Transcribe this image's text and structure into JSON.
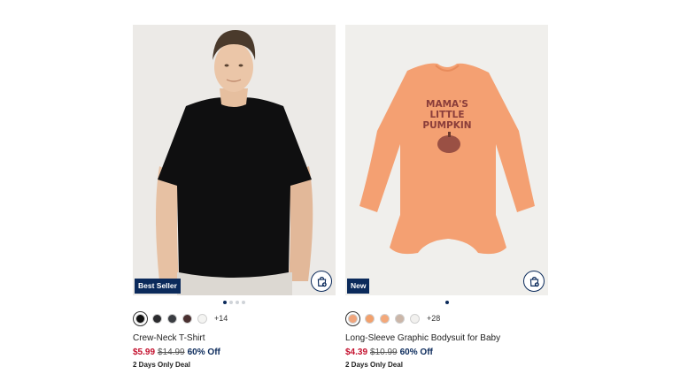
{
  "products": [
    {
      "badge": "Best Seller",
      "swatches_more": "+14",
      "swatch_colors": [
        "#111111",
        "#2b2b2e",
        "#3a3d42",
        "#4a3030",
        "#f4f4f2"
      ],
      "title": "Crew-Neck T-Shirt",
      "sale_price": "$5.99",
      "original_price": "$14.99",
      "discount": "60% Off",
      "deal": "2 Days Only Deal",
      "carousel_pages": 4,
      "carousel_active": 0
    },
    {
      "badge": "New",
      "swatches_more": "+28",
      "swatch_colors": [
        "#f0a57c",
        "#f2a06c",
        "#f3a87a",
        "#cbb6a8",
        "#f2f1ef"
      ],
      "title": "Long-Sleeve Graphic Bodysuit for Baby",
      "sale_price": "$4.39",
      "original_price": "$10.99",
      "discount": "60% Off",
      "deal": "2 Days Only Deal",
      "graphic_text": "MAMA'S LITTLE PUMPKIN",
      "carousel_pages": 1,
      "carousel_active": 0
    }
  ],
  "icons": {
    "bag": "shopping-bag-add-icon"
  },
  "colors": {
    "brand_navy": "#0b2a5b",
    "sale_red": "#c4122f"
  }
}
